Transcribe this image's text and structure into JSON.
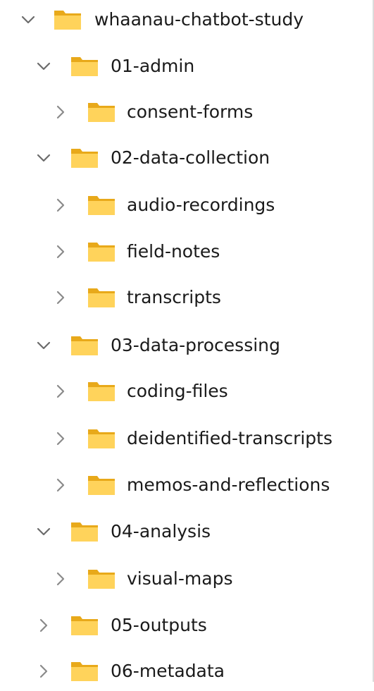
{
  "tree": {
    "root": {
      "label": "whaanau-chatbot-study",
      "expanded": true
    },
    "admin": {
      "label": "01-admin",
      "expanded": true
    },
    "consent": {
      "label": "consent-forms",
      "expanded": false
    },
    "collection": {
      "label": "02-data-collection",
      "expanded": true
    },
    "audio": {
      "label": "audio-recordings",
      "expanded": false
    },
    "fieldnotes": {
      "label": "field-notes",
      "expanded": false
    },
    "transcripts": {
      "label": "transcripts",
      "expanded": false
    },
    "processing": {
      "label": "03-data-processing",
      "expanded": true
    },
    "coding": {
      "label": "coding-files",
      "expanded": false
    },
    "deidentified": {
      "label": "deidentified-transcripts",
      "expanded": false
    },
    "memos": {
      "label": "memos-and-reflections",
      "expanded": false
    },
    "analysis": {
      "label": "04-analysis",
      "expanded": true
    },
    "visual": {
      "label": "visual-maps",
      "expanded": false
    },
    "outputs": {
      "label": "05-outputs",
      "expanded": false
    },
    "metadata": {
      "label": "06-metadata",
      "expanded": false
    }
  },
  "icons": {
    "expanded": "chevron-down-icon",
    "collapsed": "chevron-right-icon",
    "folder": "folder-icon"
  },
  "colors": {
    "folder_back": "#E8A91A",
    "folder_front": "#FFD35B",
    "chevron": "#6b6b6b",
    "text": "#1a1a1a"
  }
}
